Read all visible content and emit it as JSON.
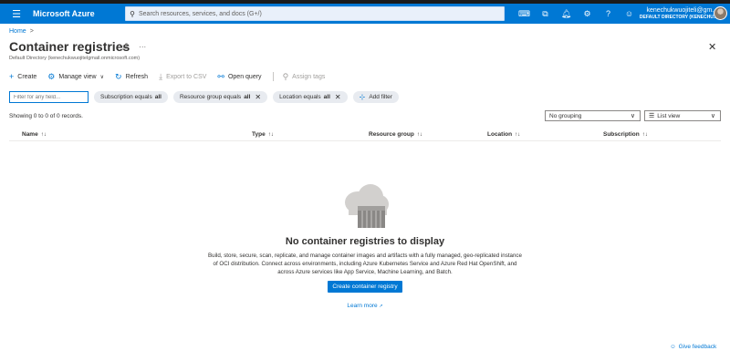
{
  "topbar": {
    "brand": "Microsoft Azure",
    "search_placeholder": "Search resources, services, and docs (G+/)",
    "account_email": "kenechukwuojiteli@gm...",
    "account_directory": "DEFAULT DIRECTORY (KENECHU..."
  },
  "breadcrumb": {
    "home": "Home",
    "separator": ">"
  },
  "page": {
    "title": "Container registries",
    "subtitle": "Default Directory (kenechukwuojitelgmail.onmicrosoft.com)"
  },
  "commands": {
    "create": "Create",
    "manage_view": "Manage view",
    "refresh": "Refresh",
    "export_csv": "Export to CSV",
    "open_query": "Open query",
    "assign_tags": "Assign tags"
  },
  "filters": {
    "input_placeholder": "Filter for any field...",
    "subscription_label": "Subscription equals",
    "subscription_value": "all",
    "resource_group_label": "Resource group equals",
    "resource_group_value": "all",
    "location_label": "Location equals",
    "location_value": "all",
    "add_filter": "Add filter"
  },
  "records": {
    "showing": "Showing 0 to 0 of 0 records.",
    "grouping": "No grouping",
    "view": "List view"
  },
  "table": {
    "columns": [
      "Name",
      "Type",
      "Resource group",
      "Location",
      "Subscription"
    ]
  },
  "empty_state": {
    "title": "No container registries to display",
    "description": "Build, store, secure, scan, replicate, and manage container images and artifacts with a fully managed, geo-replicated instance of OCI distribution. Connect across environments, including Azure Kubernetes Service and Azure Red Hat OpenShift, and across Azure services like App Service, Machine Learning, and Batch.",
    "create_button": "Create container registry",
    "learn_more": "Learn more"
  },
  "footer": {
    "feedback": "Give feedback"
  },
  "colors": {
    "accent": "#0078d4",
    "pill_bg": "#e8ebf0"
  }
}
